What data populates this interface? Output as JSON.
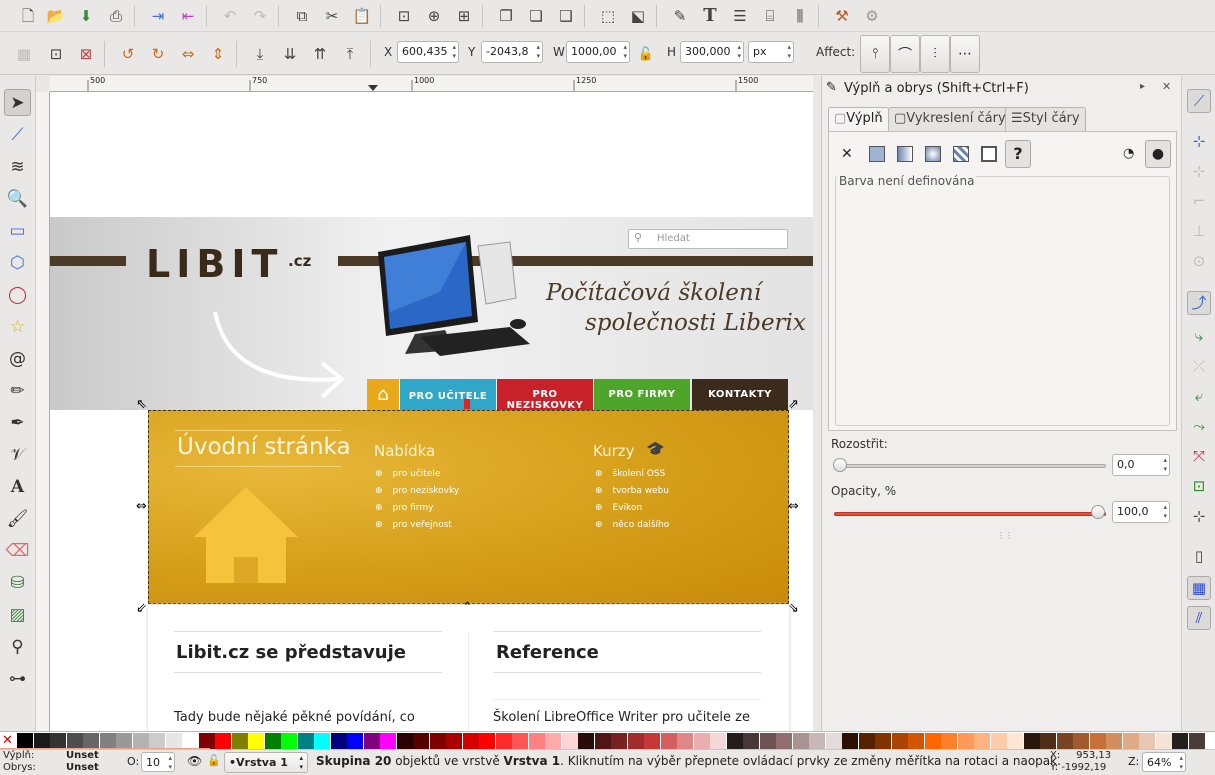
{
  "toolbar1": {
    "icons": [
      "new-icon",
      "open-icon",
      "save-icon",
      "print-icon",
      "import-icon",
      "export-icon",
      "undo-icon",
      "redo-icon",
      "duplicate-icon",
      "cut-icon",
      "paste-icon",
      "zoom-selection-icon",
      "zoom-drawing-icon",
      "zoom-page-icon",
      "group-icon",
      "ungroup-icon",
      "clone-icon",
      "transform-icon",
      "align-icon",
      "pen-icon",
      "text-icon",
      "layers-icon",
      "xml-editor-icon",
      "distribute-icon",
      "preferences-icon",
      "gear-icon"
    ]
  },
  "toolbar2": {
    "x_label": "X",
    "x_value": "600,435",
    "y_label": "Y",
    "y_value": "-2043,8",
    "w_label": "W",
    "w_value": "1000,00",
    "h_label": "H",
    "h_value": "300,000",
    "unit": "px",
    "affect_label": "Affect:"
  },
  "ruler": {
    "labels": [
      "500",
      "750",
      "1000",
      "1250",
      "1500"
    ]
  },
  "site": {
    "logo_main": "LIBIT",
    "logo_tld": ".cz",
    "search_placeholder": "Hledat",
    "tagline1": "Počítačová školení",
    "tagline2": "společnosti Liberix",
    "nav": [
      {
        "label": "PRO UČITELE",
        "color": "#2ea7c9"
      },
      {
        "label": "PRO NEZISKOVKY",
        "color": "#c8212a"
      },
      {
        "label": "PRO FIRMY",
        "color": "#4da52a"
      },
      {
        "label": "KONTAKTY",
        "color": "#3b2b1c"
      }
    ],
    "hero_title": "Úvodní stránka",
    "col1_title": "Nabídka",
    "col1_items": [
      "pro učitele",
      "pro neziskovky",
      "pro firmy",
      "pro veřejnost"
    ],
    "col2_title": "Kurzy",
    "col2_items": [
      "školení OSS",
      "tvorba webu",
      "Evikon",
      "něco dalšího"
    ],
    "section1_title": "Libit.cz se představuje",
    "section1_text": "Tady bude nějaké pěkné povídání, co",
    "section2_title": "Reference",
    "section2_text": "Školení LibreOffice Writer pro učitele ze"
  },
  "dock": {
    "title": "Výplň a obrys (Shift+Ctrl+F)",
    "tabs": [
      "Výplň",
      "Vykreslení čáry",
      "Styl čáry"
    ],
    "fill_unset_text": "Barva není definována",
    "blur_label": "Rozostřit:",
    "blur_value": "0,0",
    "opacity_label": "Opacity, %",
    "opacity_value": "100,0",
    "blur_level": 0,
    "opacity_level": 100
  },
  "palette": [
    "#000000",
    "#1a1a1a",
    "#333333",
    "#4d4d4d",
    "#666666",
    "#808080",
    "#999999",
    "#b3b3b3",
    "#cccccc",
    "#e6e6e6",
    "#ffffff",
    "#800000",
    "#ff0000",
    "#808000",
    "#ffff00",
    "#008000",
    "#00ff00",
    "#008080",
    "#00ffff",
    "#000080",
    "#0000ff",
    "#800080",
    "#ff00ff",
    "#2b0000",
    "#550000",
    "#800000",
    "#aa0000",
    "#d40000",
    "#ff0000",
    "#ff2a2a",
    "#ff5555",
    "#ff8080",
    "#ffaaaa",
    "#ffd5d5",
    "#280b0b",
    "#501616",
    "#782121",
    "#a02c2c",
    "#c83737",
    "#d35f5f",
    "#de8787",
    "#e9afaf",
    "#f4d7d7",
    "#241c1c",
    "#483737",
    "#6c5353",
    "#916f6f",
    "#ac9393",
    "#c8b7b7",
    "#e3dbdb",
    "#2b1100",
    "#552200",
    "#803300",
    "#aa4400",
    "#d45500",
    "#ff6600",
    "#ff7f2a",
    "#ff9955",
    "#ffb380",
    "#ffccaa",
    "#ffe6d5",
    "#28170b",
    "#502d16",
    "#784421",
    "#a05a2c",
    "#c87137",
    "#d38d5f",
    "#deaa87",
    "#e9c6af",
    "#f4e3d7",
    "#241f1c",
    "#483e37"
  ],
  "status": {
    "fill_label": "Výplň:",
    "fill_value": "Unset",
    "stroke_label": "Obrys:",
    "stroke_value": "Unset",
    "opacity_label": "O:",
    "opacity_value": "10",
    "layer": "•Vrstva 1",
    "message_bold1": "Skupina 20",
    "message_mid": " objektů ve vrstvě ",
    "message_bold2": "Vrstva 1",
    "message_tail": ". Kliknutím na výběr přepnete ovládací prvky ze změny měřítka na rotaci a naopak.",
    "cursor_x": "X:     953,13",
    "cursor_y": "Y: -1992,19",
    "zoom_label": "Z:",
    "zoom_value": "64%"
  }
}
